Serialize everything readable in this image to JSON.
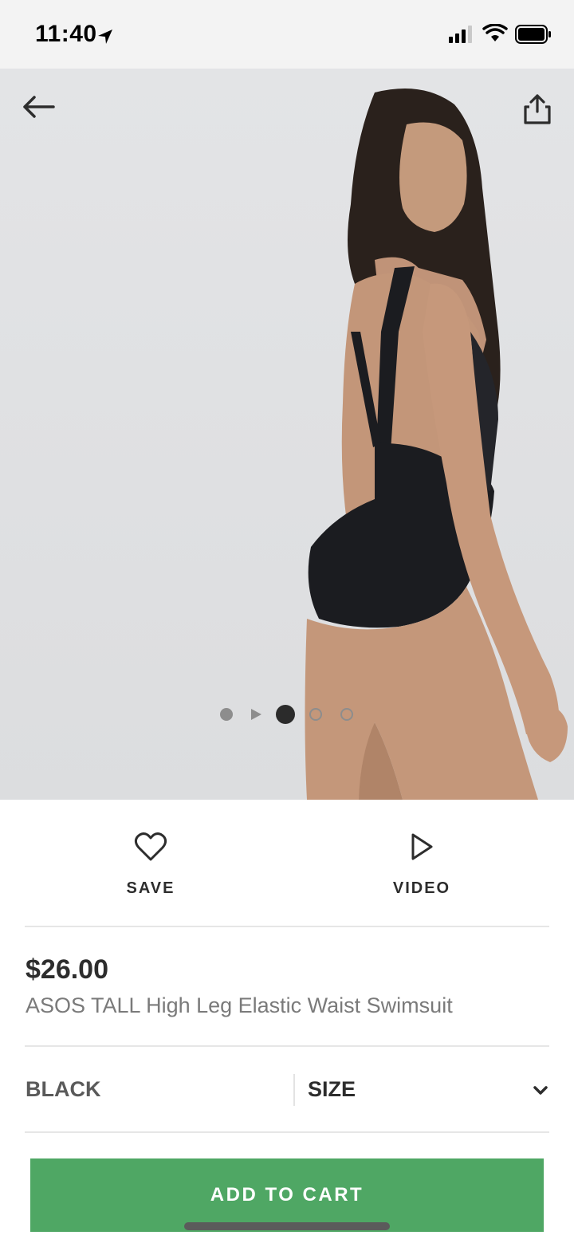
{
  "status_bar": {
    "time": "11:40",
    "icons": [
      "location-arrow-icon",
      "cellular-signal-icon",
      "wifi-icon",
      "battery-icon"
    ]
  },
  "nav": {
    "back_icon": "arrow-left-icon",
    "share_icon": "share-icon"
  },
  "gallery": {
    "indicators": [
      "dot",
      "play",
      "dot-active",
      "dot-outline",
      "dot-outline"
    ],
    "active_index": 2
  },
  "actions": {
    "save_label": "SAVE",
    "video_label": "VIDEO"
  },
  "product": {
    "price": "$26.00",
    "name": "ASOS TALL High Leg Elastic Waist Swimsuit"
  },
  "selectors": {
    "color_value": "BLACK",
    "size_label": "SIZE"
  },
  "cart": {
    "button_label": "ADD TO CART"
  },
  "colors": {
    "accent_green": "#4fa764",
    "text_dark": "#2d2d2d",
    "text_muted": "#7a7a7a"
  }
}
